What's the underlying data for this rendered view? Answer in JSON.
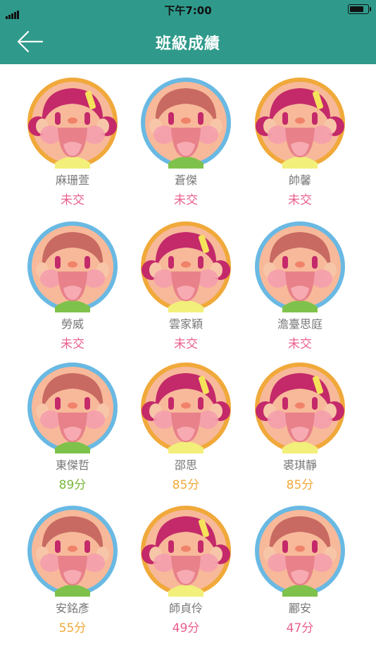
{
  "status_bar": {
    "time": "下午7:00"
  },
  "header": {
    "title": "班級成績",
    "back_icon": "arrow-left-icon"
  },
  "colors": {
    "header": "#2f9a8b",
    "not_submitted": "#e95f8c",
    "score_green": "#7ab83a",
    "score_orange": "#f0a93a",
    "score_pink": "#e95f8c"
  },
  "students": [
    {
      "name": "麻珊萱",
      "score": "未交",
      "avatar": "girl",
      "status": "pink"
    },
    {
      "name": "蒼傑",
      "score": "未交",
      "avatar": "boy",
      "status": "pink"
    },
    {
      "name": "帥馨",
      "score": "未交",
      "avatar": "girl",
      "status": "pink"
    },
    {
      "name": "勞威",
      "score": "未交",
      "avatar": "boy",
      "status": "pink"
    },
    {
      "name": "雲家穎",
      "score": "未交",
      "avatar": "girl",
      "status": "pink"
    },
    {
      "name": "澹臺思庭",
      "score": "未交",
      "avatar": "boy",
      "status": "pink"
    },
    {
      "name": "東傑哲",
      "score": "89分",
      "avatar": "boy",
      "status": "green"
    },
    {
      "name": "邵思",
      "score": "85分",
      "avatar": "girl",
      "status": "orange"
    },
    {
      "name": "裘琪靜",
      "score": "85分",
      "avatar": "girl",
      "status": "orange"
    },
    {
      "name": "安銘彥",
      "score": "55分",
      "avatar": "boy",
      "status": "orange"
    },
    {
      "name": "師貞伶",
      "score": "49分",
      "avatar": "girl",
      "status": "pink"
    },
    {
      "name": "酈安",
      "score": "47分",
      "avatar": "boy",
      "status": "pink"
    }
  ]
}
